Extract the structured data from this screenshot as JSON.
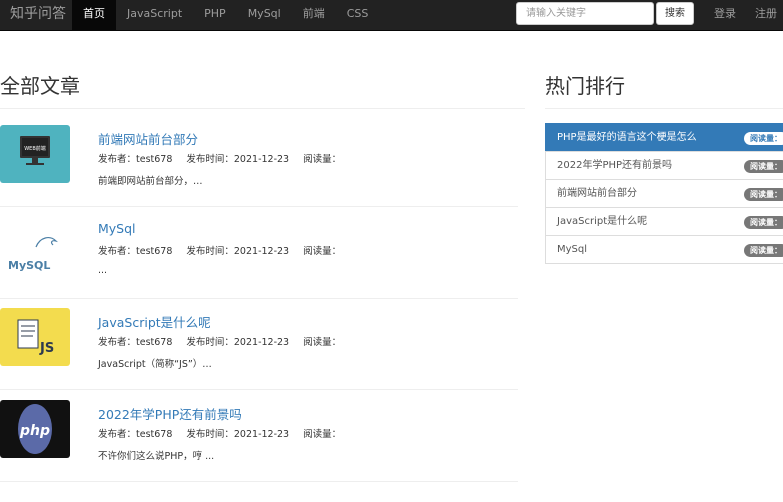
{
  "navbar": {
    "brand": "知乎问答",
    "items": [
      "首页",
      "JavaScript",
      "PHP",
      "MySql",
      "前端",
      "CSS"
    ],
    "search_placeholder": "请输入关键字",
    "search_button": "搜索",
    "login": "登录",
    "register": "注册"
  },
  "main": {
    "title": "全部文章",
    "articles": [
      {
        "title": "前端网站前台部分",
        "author": "发布者：test678",
        "time": "发布时间：2021-12-23",
        "reads": "阅读量：",
        "excerpt": "前端即网站前台部分，…",
        "thumb_text": "WEB前端"
      },
      {
        "title": "MySql",
        "author": "发布者：test678",
        "time": "发布时间：2021-12-23",
        "reads": "阅读量：",
        "excerpt": "...",
        "thumb_text": "MySQL"
      },
      {
        "title": "JavaScript是什么呢",
        "author": "发布者：test678",
        "time": "发布时间：2021-12-23",
        "reads": "阅读量：",
        "excerpt": "JavaScript（简称“JS”）…",
        "thumb_text": "JS"
      },
      {
        "title": "2022年学PHP还有前景吗",
        "author": "发布者：test678",
        "time": "发布时间：2021-12-23",
        "reads": "阅读量：",
        "excerpt": "不许你们这么说PHP，哼 ...",
        "thumb_text": "php"
      }
    ]
  },
  "sidebar": {
    "title": "热门排行",
    "items": [
      {
        "label": "PHP是最好的语言这个梗是怎么",
        "badge": "阅读量："
      },
      {
        "label": "2022年学PHP还有前景吗",
        "badge": "阅读量："
      },
      {
        "label": "前端网站前台部分",
        "badge": "阅读量："
      },
      {
        "label": "JavaScript是什么呢",
        "badge": "阅读量："
      },
      {
        "label": "MySql",
        "badge": "阅读量："
      }
    ]
  },
  "colors": {
    "navbar": "#222222",
    "link": "#337ab7",
    "badge": "#777777"
  }
}
